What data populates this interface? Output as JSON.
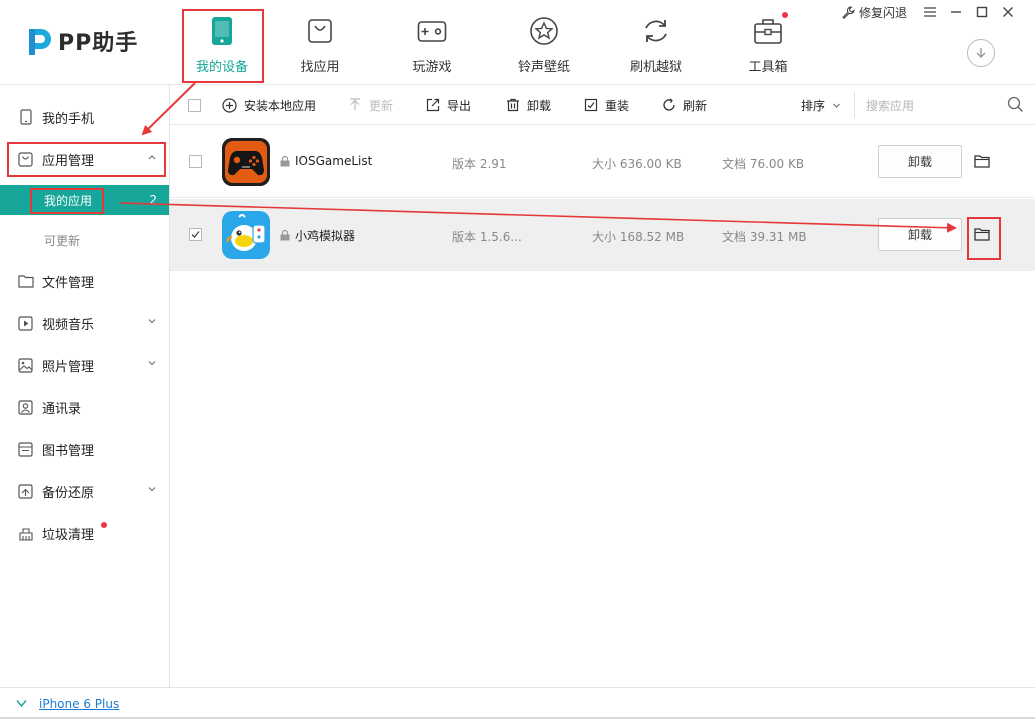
{
  "app": {
    "logo_text": "PP助手"
  },
  "nav": {
    "items": [
      {
        "label": "我的设备",
        "active": true
      },
      {
        "label": "找应用"
      },
      {
        "label": "玩游戏"
      },
      {
        "label": "铃声壁纸"
      },
      {
        "label": "刷机越狱"
      },
      {
        "label": "工具箱",
        "badge": true
      }
    ]
  },
  "window": {
    "fix_crash_label": "修复闪退"
  },
  "sidebar": {
    "items": [
      {
        "label": "我的手机"
      },
      {
        "label": "应用管理",
        "expanded": true
      },
      {
        "label": "文件管理"
      },
      {
        "label": "视频音乐"
      },
      {
        "label": "照片管理"
      },
      {
        "label": "通讯录"
      },
      {
        "label": "图书管理"
      },
      {
        "label": "备份还原"
      },
      {
        "label": "垃圾清理",
        "badge": true
      }
    ],
    "sub_items": [
      {
        "label": "我的应用",
        "count": "2",
        "active": true
      },
      {
        "label": "可更新"
      }
    ]
  },
  "toolbar": {
    "install_label": "安装本地应用",
    "update_label": "更新",
    "export_label": "导出",
    "uninstall_label": "卸载",
    "reinstall_label": "重装",
    "refresh_label": "刷新",
    "sort_label": "排序",
    "search_placeholder": "搜索应用"
  },
  "apps": [
    {
      "name": "IOSGameList",
      "version": "版本 2.91",
      "size": "大小 636.00 KB",
      "docs": "文档 76.00 KB",
      "uninstall_label": "卸载",
      "checked": false
    },
    {
      "name": "小鸡模拟器",
      "version": "版本 1.5.6...",
      "size": "大小 168.52 MB",
      "docs": "文档 39.31 MB",
      "uninstall_label": "卸载",
      "checked": true
    }
  ],
  "status": {
    "device_name": "iPhone 6 Plus"
  },
  "colors": {
    "accent": "#16a69a",
    "annotation": "#e5383a",
    "badge": "#f0324a",
    "link": "#1a7ad6"
  }
}
